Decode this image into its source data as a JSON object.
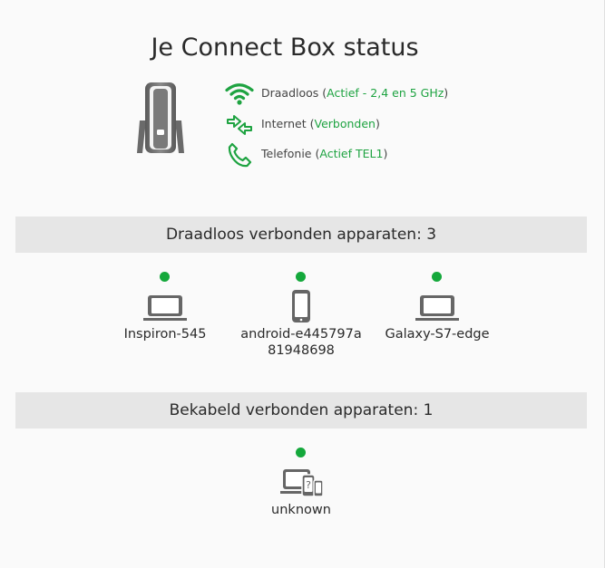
{
  "header": {
    "title": "Je Connect Box status"
  },
  "status": [
    {
      "icon": "wifi-icon",
      "label": "Draadloos (",
      "value": "Actief - 2,4 en 5 GHz",
      "suffix": ")"
    },
    {
      "icon": "internet-icon",
      "label": "Internet (",
      "value": "Verbonden",
      "suffix": ")"
    },
    {
      "icon": "phone-icon",
      "label": "Telefonie (",
      "value": "Actief TEL1",
      "suffix": ")"
    }
  ],
  "wireless": {
    "title": "Draadloos verbonden apparaten: 3",
    "devices": [
      {
        "icon": "laptop-icon",
        "name": "Inspiron-545",
        "online": true
      },
      {
        "icon": "smartphone-icon",
        "name": "android-e445797a81948698",
        "online": true
      },
      {
        "icon": "laptop-icon",
        "name": "Galaxy-S7-edge",
        "online": true
      }
    ]
  },
  "wired": {
    "title": "Bekabeld verbonden apparaten: 1",
    "devices": [
      {
        "icon": "unknown-device-icon",
        "name": "unknown",
        "online": true
      }
    ]
  },
  "colors": {
    "accent_green": "#1ea341",
    "online_dot": "#14a83b",
    "device_gray": "#666666",
    "section_bg": "#e6e6e6"
  }
}
